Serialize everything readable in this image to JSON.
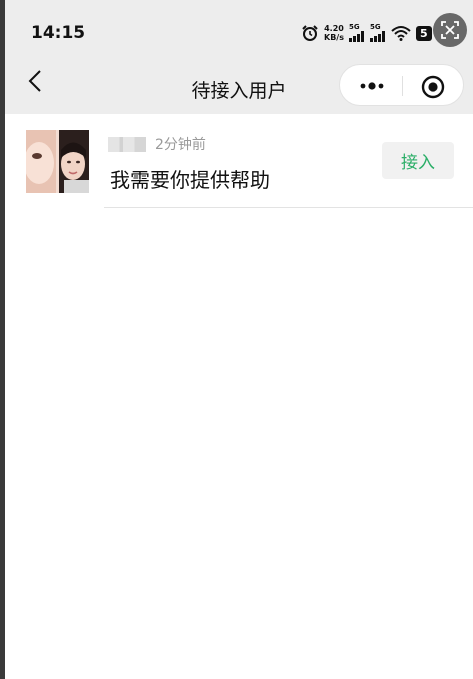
{
  "status_bar": {
    "time": "14:15",
    "net_speed_value": "4.20",
    "net_speed_unit": "KB/s",
    "signal1_label": "5G",
    "signal2_label": "5G",
    "battery": "5",
    "icons": [
      "alarm-icon",
      "signal-icon",
      "signal-icon",
      "wifi-icon",
      "battery-icon",
      "screenshot-icon"
    ]
  },
  "nav": {
    "title": "待接入用户",
    "back_icon": "chevron-left-icon",
    "more_icon": "more-dots-icon",
    "close_icon": "target-circle-icon"
  },
  "pending_users": [
    {
      "time_ago": "2分钟前",
      "message": "我需要你提供帮助",
      "accept_label": "接入"
    }
  ],
  "colors": {
    "accent_green": "#2aae67",
    "header_bg": "#ededed"
  }
}
